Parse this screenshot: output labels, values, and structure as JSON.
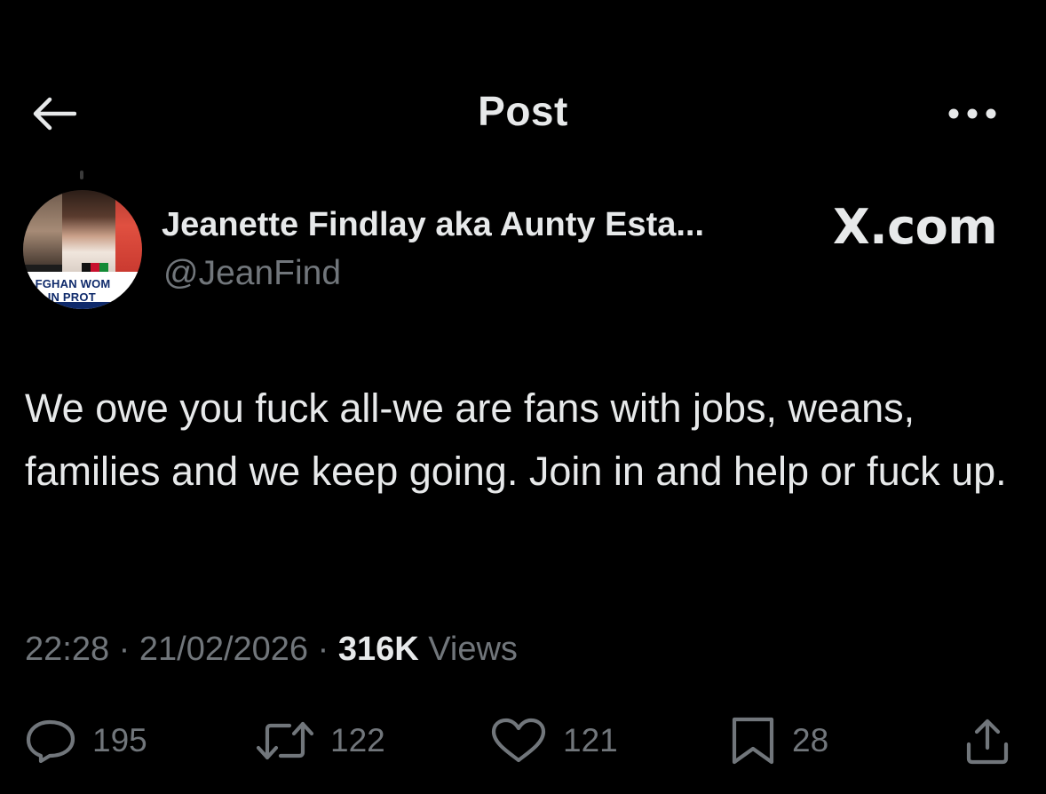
{
  "header": {
    "title": "Post",
    "back_icon": "arrow-left-icon",
    "more_icon": "more-horizontal-icon"
  },
  "author": {
    "display_name": "Jeanette Findlay aka Aunty Esta...",
    "handle": "@JeanFind",
    "avatar_banner_text": "AFGHAN WOM\nNG IN PROT"
  },
  "watermark": "X.com",
  "post": {
    "text": "We owe you fuck all-we are fans with jobs, weans, families and we keep going. Join in and help or fuck up."
  },
  "meta": {
    "time": "22:28",
    "separator": " · ",
    "date": "21/02/2026",
    "views_count": "316K",
    "views_label": "Views"
  },
  "actions": {
    "replies": "195",
    "reposts": "122",
    "likes": "121",
    "bookmarks": "28"
  },
  "colors": {
    "background": "#000000",
    "primary_text": "#e7e9ea",
    "secondary_text": "#71767b"
  }
}
